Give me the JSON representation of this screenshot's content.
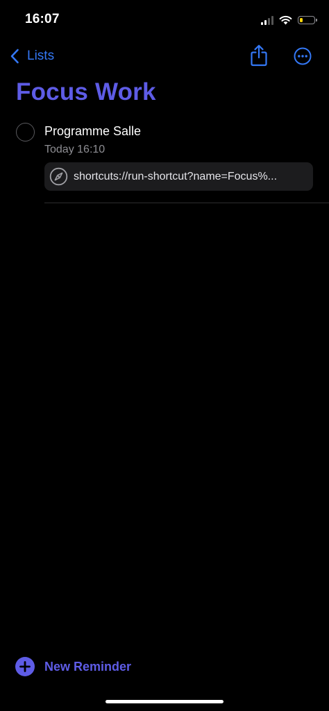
{
  "status_bar": {
    "time": "16:07",
    "battery_level": 0.25
  },
  "nav": {
    "back_label": "Lists"
  },
  "list": {
    "title": "Focus Work",
    "title_color": "#5e5ce6"
  },
  "reminders": [
    {
      "title": "Programme Salle",
      "date": "Today 16:10",
      "url": "shortcuts://run-shortcut?name=Focus%..."
    }
  ],
  "footer": {
    "new_reminder_label": "New Reminder"
  },
  "colors": {
    "accent": "#5e5ce6",
    "nav_tint": "#3478f6",
    "background": "#000000",
    "battery": "#ffd60a"
  },
  "icons": {
    "back": "chevron-left-icon",
    "share": "share-icon",
    "more": "ellipsis-circle-icon",
    "url": "safari-compass-icon",
    "add": "plus-circle-icon"
  }
}
